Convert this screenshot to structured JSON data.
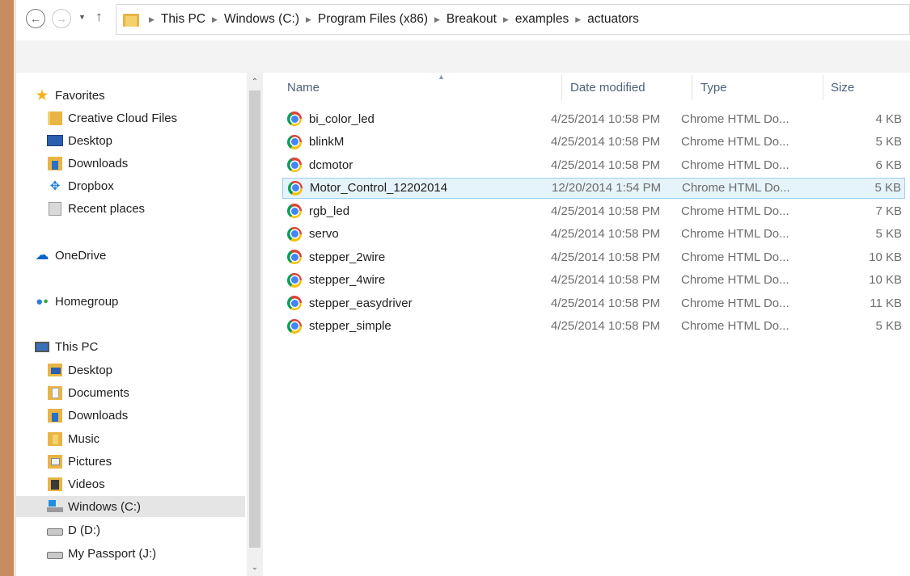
{
  "breadcrumbs": [
    "This PC",
    "Windows (C:)",
    "Program Files (x86)",
    "Breakout",
    "examples",
    "actuators"
  ],
  "nav": {
    "favorites": {
      "label": "Favorites",
      "items": [
        "Creative Cloud Files",
        "Desktop",
        "Downloads",
        "Dropbox",
        "Recent places"
      ]
    },
    "onedrive": "OneDrive",
    "homegroup": "Homegroup",
    "thispc": {
      "label": "This PC",
      "items": [
        "Desktop",
        "Documents",
        "Downloads",
        "Music",
        "Pictures",
        "Videos",
        "Windows (C:)",
        "D (D:)",
        "My Passport (J:)"
      ]
    },
    "selected": "Windows (C:)"
  },
  "columns": {
    "name": "Name",
    "date": "Date modified",
    "type": "Type",
    "size": "Size"
  },
  "files": [
    {
      "name": "bi_color_led",
      "date": "4/25/2014 10:58 PM",
      "type": "Chrome HTML Do...",
      "size": "4 KB"
    },
    {
      "name": "blinkM",
      "date": "4/25/2014 10:58 PM",
      "type": "Chrome HTML Do...",
      "size": "5 KB"
    },
    {
      "name": "dcmotor",
      "date": "4/25/2014 10:58 PM",
      "type": "Chrome HTML Do...",
      "size": "6 KB"
    },
    {
      "name": "Motor_Control_12202014",
      "date": "12/20/2014 1:54 PM",
      "type": "Chrome HTML Do...",
      "size": "5 KB"
    },
    {
      "name": "rgb_led",
      "date": "4/25/2014 10:58 PM",
      "type": "Chrome HTML Do...",
      "size": "7 KB"
    },
    {
      "name": "servo",
      "date": "4/25/2014 10:58 PM",
      "type": "Chrome HTML Do...",
      "size": "5 KB"
    },
    {
      "name": "stepper_2wire",
      "date": "4/25/2014 10:58 PM",
      "type": "Chrome HTML Do...",
      "size": "10 KB"
    },
    {
      "name": "stepper_4wire",
      "date": "4/25/2014 10:58 PM",
      "type": "Chrome HTML Do...",
      "size": "10 KB"
    },
    {
      "name": "stepper_easydriver",
      "date": "4/25/2014 10:58 PM",
      "type": "Chrome HTML Do...",
      "size": "11 KB"
    },
    {
      "name": "stepper_simple",
      "date": "4/25/2014 10:58 PM",
      "type": "Chrome HTML Do...",
      "size": "5 KB"
    }
  ],
  "selected_file": "Motor_Control_12202014",
  "colors": {
    "accent_folder": "#e8b545",
    "selection_bg": "#e5f3fb",
    "selection_border": "#99d1ef",
    "window_edge": "#c98c5f"
  }
}
